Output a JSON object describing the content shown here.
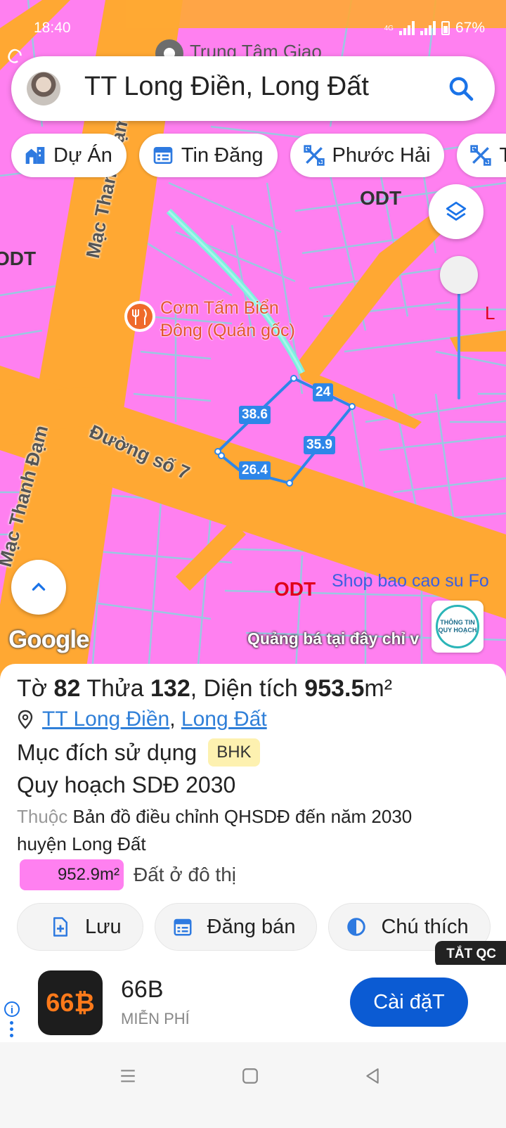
{
  "status_bar": {
    "time": "18:40",
    "network": "4G",
    "battery": "67%"
  },
  "search": {
    "query": "TT Long Điền, Long Đất"
  },
  "chips": [
    {
      "label": "Dự Án",
      "icon": "building-icon"
    },
    {
      "label": "Tin Đăng",
      "icon": "listing-icon"
    },
    {
      "label": "Phước Hải",
      "icon": "tools-icon"
    },
    {
      "label": "T",
      "icon": "tools-icon"
    }
  ],
  "map": {
    "poi_top": "Trung Tâm Giao",
    "restaurant_line1": "Cơm Tấm Biển",
    "restaurant_line2": "Đông (Quán gốc)",
    "street_1": "Mạc Thanh Đạm",
    "street_2": "Mạc Thanh Đạm",
    "street_3": "Đường số 7",
    "zone_1": "ODT",
    "zone_2": "ODT",
    "zone_3": "ODT",
    "zone_edge": "L",
    "shop": "Shop bao cao su Fo",
    "edge_left_top": "C",
    "parcel_edges": [
      "24",
      "38.6",
      "35.9",
      "26.4"
    ],
    "attribution": "Google",
    "ad_text": "Quảng bá tại đây chỉ v",
    "badge_line1": "THÔNG TIN",
    "badge_line2": "QUY HOẠCH"
  },
  "parcel": {
    "sheet_label": "Tờ",
    "sheet_no": "82",
    "plot_label": "Thửa",
    "plot_no": "132",
    "area_label": ", Diện tích",
    "area_value": "953.5",
    "area_unit": "m²",
    "location_1": "TT Long Điền",
    "location_sep": ",",
    "location_2": "Long Đất",
    "use_label": "Mục đích sử dụng",
    "use_code": "BHK",
    "plan_title": "Quy hoạch SDĐ 2030",
    "belongs_label": "Thuộc",
    "belongs_text": "Bản đồ điều chỉnh QHSDĐ đến năm 2030 huyện Long Đất",
    "legend_area": "952.9m²",
    "legend_text": "Đất ở đô thị"
  },
  "actions": [
    {
      "label": "Lưu",
      "icon": "save-file-icon"
    },
    {
      "label": "Đăng bán",
      "icon": "calendar-icon"
    },
    {
      "label": "Chú thích",
      "icon": "contrast-icon"
    }
  ],
  "ad": {
    "close_label": "TẮT QC",
    "app_name": "66B",
    "app_logo": "66₿",
    "price": "MIỄN PHÍ",
    "install_label": "Cài đặT"
  },
  "colors": {
    "land_pink": "#ff80f0",
    "road_orange": "#ffa833",
    "parcel_blue": "#2e86e8",
    "accent_blue": "#0b5bd3"
  }
}
